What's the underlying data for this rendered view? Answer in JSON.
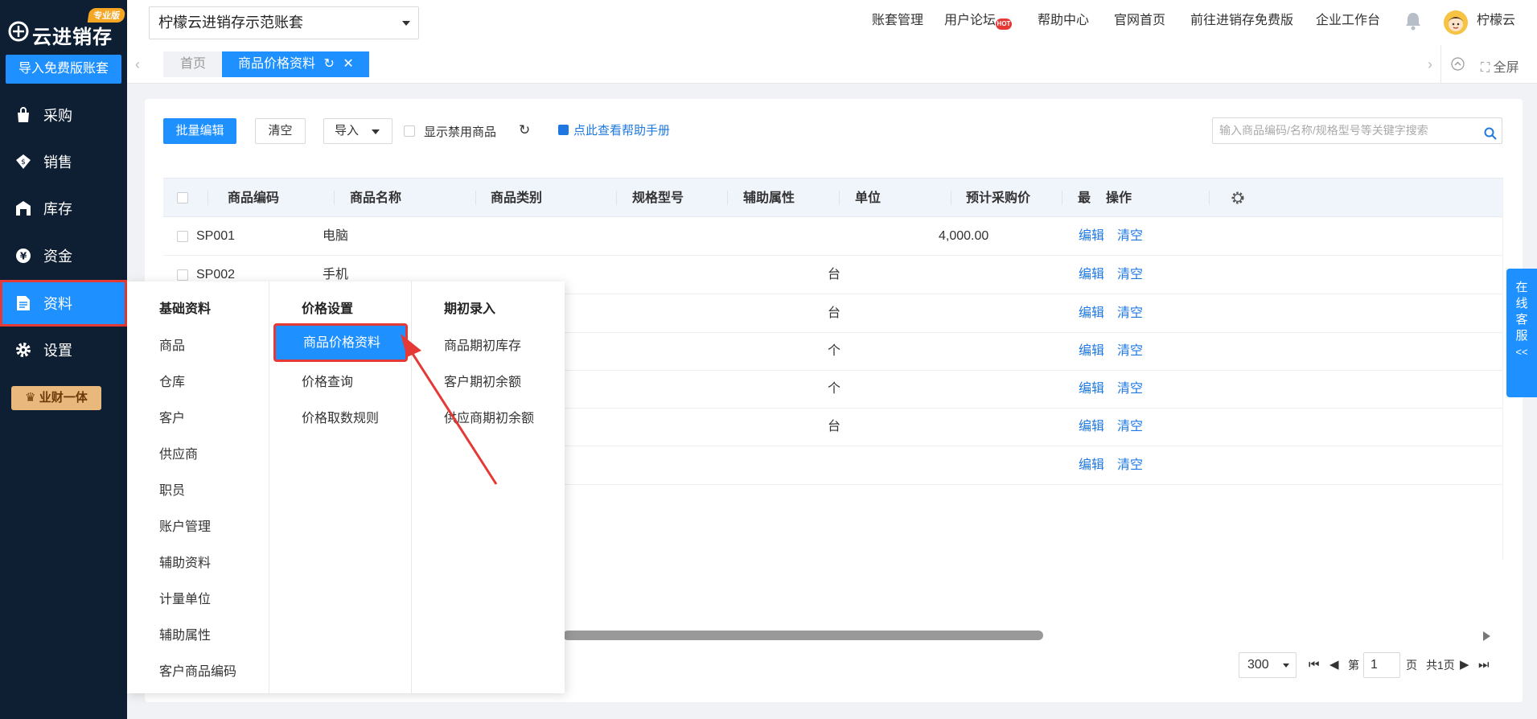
{
  "sidebar": {
    "brand": "云进销存",
    "edition": "专业版",
    "import_label": "导入免费版账套",
    "items": [
      {
        "label": "采购",
        "icon": "bag-icon"
      },
      {
        "label": "销售",
        "icon": "sales-icon"
      },
      {
        "label": "库存",
        "icon": "warehouse-icon"
      },
      {
        "label": "资金",
        "icon": "yen-icon"
      },
      {
        "label": "资料",
        "icon": "document-icon"
      },
      {
        "label": "设置",
        "icon": "gear-icon"
      }
    ],
    "vip_label": "业财一体"
  },
  "topbar": {
    "account": "柠檬云进销存示范账套",
    "links": [
      "账套管理",
      "用户论坛",
      "帮助中心",
      "官网首页",
      "前往进销存免费版",
      "企业工作台"
    ],
    "hot_badge": "HOT",
    "username": "柠檬云"
  },
  "tabs": {
    "home": "首页",
    "active": "商品价格资料",
    "fullscreen": "全屏"
  },
  "toolbar": {
    "batch_edit": "批量编辑",
    "clear": "清空",
    "import": "导入",
    "show_disabled": "显示禁用商品",
    "help": "点此查看帮助手册",
    "search_placeholder": "输入商品编码/名称/规格型号等关键字搜索"
  },
  "table": {
    "headers": [
      "商品编码",
      "商品名称",
      "商品类别",
      "规格型号",
      "辅助属性",
      "单位",
      "预计采购价",
      "最",
      "操作"
    ],
    "rows": [
      {
        "code": "SP001",
        "name": "电脑",
        "unit": "",
        "price": "4,000.00"
      },
      {
        "code": "SP002",
        "name": "手机",
        "unit": "台",
        "price": ""
      },
      {
        "code": "",
        "name": "",
        "unit": "台",
        "price": ""
      },
      {
        "code": "",
        "name": "",
        "unit": "个",
        "price": ""
      },
      {
        "code": "",
        "name": "",
        "unit": "个",
        "price": ""
      },
      {
        "code": "",
        "name": "",
        "unit": "台",
        "price": ""
      },
      {
        "code": "",
        "name": "",
        "unit": "",
        "price": ""
      }
    ],
    "edit": "编辑",
    "clear": "清空"
  },
  "pager": {
    "page_size": "300",
    "page_prefix": "第",
    "page": "1",
    "page_suffix": "页",
    "total": "共1页"
  },
  "menu": {
    "columns": [
      {
        "title": "基础资料",
        "items": [
          "商品",
          "仓库",
          "客户",
          "供应商",
          "职员",
          "账户管理",
          "辅助资料",
          "计量单位",
          "辅助属性",
          "客户商品编码"
        ]
      },
      {
        "title": "价格设置",
        "items": [
          "商品价格资料",
          "价格查询",
          "价格取数规则"
        ]
      },
      {
        "title": "期初录入",
        "items": [
          "商品期初库存",
          "客户期初余额",
          "供应商期初余额"
        ]
      }
    ]
  },
  "service": {
    "label": "在线客服",
    "arrow": "<<"
  },
  "colors": {
    "primary": "#1e90ff",
    "sidebar": "#0e1e33",
    "highlight": "#e53935"
  }
}
